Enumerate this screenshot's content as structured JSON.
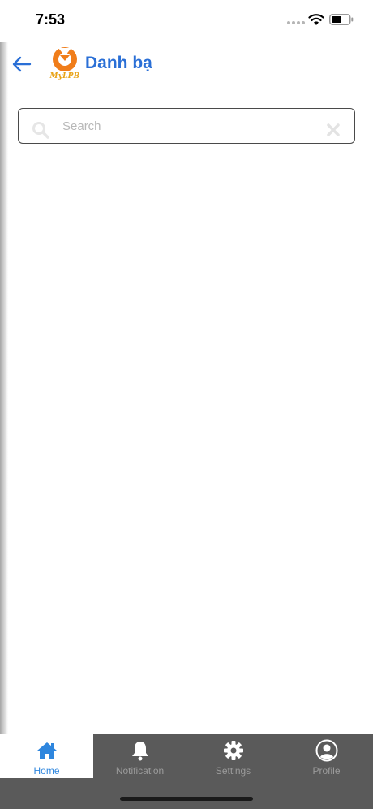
{
  "status_bar": {
    "time": "7:53"
  },
  "header": {
    "title": "Danh bạ",
    "logo_text": "MyLPB",
    "accent_color": "#2a6fd6",
    "logo_color": "#f07d1a"
  },
  "search": {
    "placeholder": "Search",
    "value": ""
  },
  "tabs": [
    {
      "label": "Home",
      "icon": "home-icon",
      "active": true
    },
    {
      "label": "Notification",
      "icon": "bell-icon",
      "active": false
    },
    {
      "label": "Settings",
      "icon": "gear-icon",
      "active": false
    },
    {
      "label": "Profile",
      "icon": "user-icon",
      "active": false
    }
  ],
  "colors": {
    "tab_active": "#2e86de",
    "tab_bar": "#5a5a5a"
  }
}
